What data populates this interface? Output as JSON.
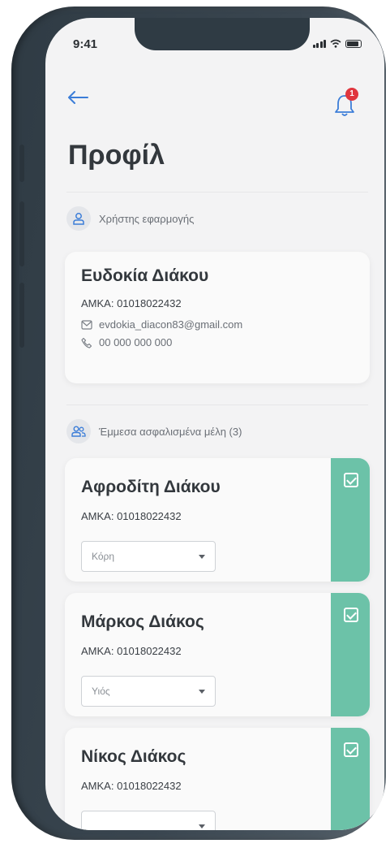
{
  "status_bar": {
    "time": "9:41"
  },
  "header": {
    "title": "Προφίλ",
    "notification_count": "1"
  },
  "app_user_section": {
    "label": "Χρήστης εφαρμογής",
    "name": "Ευδοκία Διάκου",
    "amka": "ΑΜΚΑ: 01018022432",
    "email": "evdokia_diacon83@gmail.com",
    "phone": "00 000 000 000"
  },
  "members_section": {
    "label": "Έμμεσα ασφαλισμένα μέλη (3)",
    "members": [
      {
        "name": "Αφροδίτη Διάκου",
        "amka": "ΑΜΚΑ: 01018022432",
        "relation": "Κόρη"
      },
      {
        "name": "Μάρκος Διάκος",
        "amka": "ΑΜΚΑ: 01018022432",
        "relation": "Υιός"
      },
      {
        "name": "Νίκος Διάκος",
        "amka": "ΑΜΚΑ: 01018022432",
        "relation": ""
      }
    ]
  },
  "colors": {
    "accent": "#6cc2a8",
    "badge": "#e0363e",
    "link_blue": "#3b7dd8",
    "phone_frame": "#2f3b44"
  }
}
